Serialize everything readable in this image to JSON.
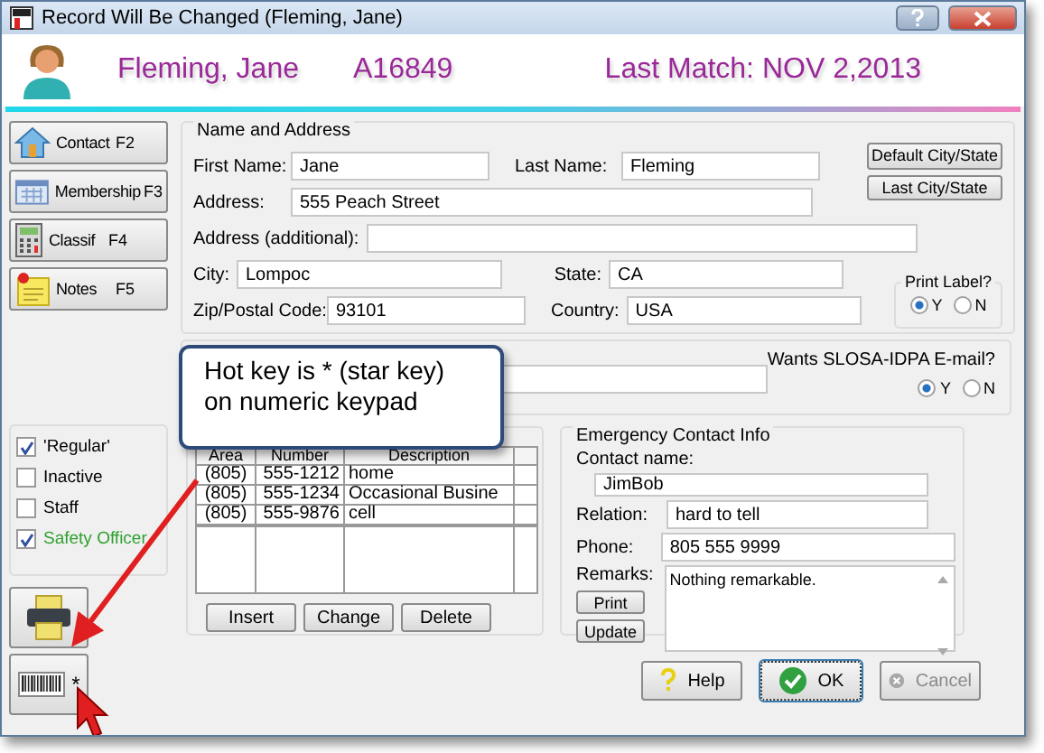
{
  "window": {
    "title": "Record Will Be Changed  (Fleming, Jane)"
  },
  "header": {
    "name": "Fleming, Jane",
    "member_id": "A16849",
    "last_match": "Last Match: NOV  2,2013"
  },
  "nav": [
    {
      "label": "Contact",
      "key": "F2",
      "kind": "house"
    },
    {
      "label": "Membership",
      "key": "F3",
      "kind": "calendar"
    },
    {
      "label": "Classif",
      "key": "F4",
      "kind": "calculator"
    },
    {
      "label": "Notes",
      "key": "F5",
      "kind": "note"
    }
  ],
  "name_address": {
    "title": "Name and Address",
    "rows": [
      [
        {
          "label": "First Name:",
          "value": "Jane"
        },
        {
          "label": "Last Name:",
          "value": "Fleming"
        }
      ],
      [
        {
          "label": "Address:",
          "value": "555 Peach Street"
        }
      ],
      [
        {
          "label": "Address (additional):"
        }
      ],
      [
        {
          "label": "City:",
          "value": "Lompoc"
        },
        {
          "label": "State:",
          "value": "CA"
        }
      ],
      [
        {
          "label": "Zip/Postal Code:",
          "value": "93101"
        },
        {
          "label": "Country:",
          "value": "USA"
        }
      ]
    ],
    "buttons": [
      "Default City/State",
      "Last City/State"
    ],
    "print_label": {
      "title": "Print Label?",
      "options": [
        {
          "label": "Y",
          "selected": true
        },
        {
          "label": "N",
          "selected": false
        }
      ]
    }
  },
  "email": {
    "question": "Wants SLOSA-IDPA E-mail?",
    "options": [
      {
        "label": "Y",
        "selected": true
      },
      {
        "label": "N",
        "selected": false
      }
    ]
  },
  "classifications": [
    {
      "label": "'Regular'",
      "checked": true,
      "highlighted": false
    },
    {
      "label": "Inactive",
      "checked": false,
      "highlighted": false
    },
    {
      "label": "Staff",
      "checked": false,
      "highlighted": false
    },
    {
      "label": "Safety Officer",
      "checked": true,
      "highlighted": true
    }
  ],
  "barcode_button": {
    "label": "*"
  },
  "phones": {
    "columns": [
      "Area",
      "Number",
      "Description"
    ],
    "rows": [
      [
        "(805)",
        "555-1212",
        "home"
      ],
      [
        "(805)",
        "555-1234",
        "Occasional Busine"
      ],
      [
        "(805)",
        "555-9876",
        "cell"
      ]
    ],
    "buttons": [
      "Insert",
      "Change",
      "Delete"
    ]
  },
  "emergency": {
    "title": "Emergency Contact Info",
    "contact_label": "Contact name:",
    "contact": "JimBob",
    "relation_label": "Relation:",
    "relation": "hard to tell",
    "phone_label": "Phone:",
    "phone": "805 555 9999",
    "remarks_label": "Remarks:",
    "remarks": "Nothing remarkable.",
    "buttons": [
      "Print",
      "Update"
    ]
  },
  "footer_buttons": [
    {
      "label": "Help",
      "kind": "help",
      "disabled": false
    },
    {
      "label": "OK",
      "kind": "ok",
      "disabled": false
    },
    {
      "label": "Cancel",
      "kind": "cancel",
      "disabled": true
    }
  ],
  "callout": {
    "text": "Hot key is * (star key) on numeric keypad"
  }
}
